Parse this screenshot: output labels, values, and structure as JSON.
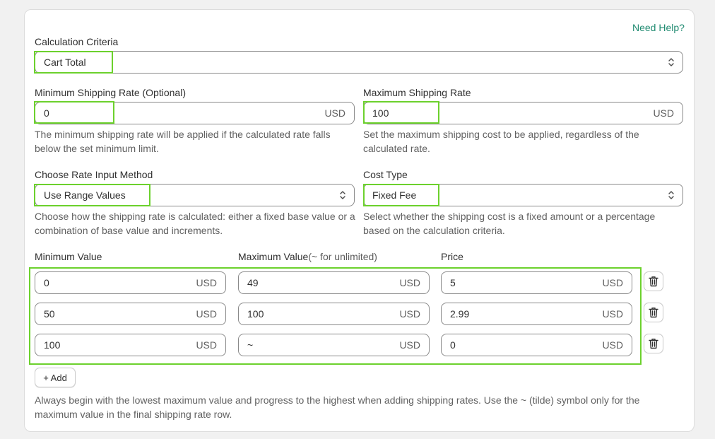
{
  "help_link": "Need Help?",
  "calculation_criteria": {
    "label": "Calculation Criteria",
    "value": "Cart Total"
  },
  "min_rate": {
    "label": "Minimum Shipping Rate (Optional)",
    "value": "0",
    "unit": "USD",
    "help": "The minimum shipping rate will be applied if the calculated rate falls below the set minimum limit."
  },
  "max_rate": {
    "label": "Maximum Shipping Rate",
    "value": "100",
    "unit": "USD",
    "help": "Set the maximum shipping cost to be applied, regardless of the calculated rate."
  },
  "rate_method": {
    "label": "Choose Rate Input Method",
    "value": "Use Range Values",
    "help": "Choose how the shipping rate is calculated: either a fixed base value or a combination of base value and increments."
  },
  "cost_type": {
    "label": "Cost Type",
    "value": "Fixed Fee",
    "help": "Select whether the shipping cost is a fixed amount or a percentage based on the calculation criteria."
  },
  "ranges": {
    "col_min": "Minimum Value",
    "col_max": "Maximum Value",
    "col_max_note": "(~ for unlimited)",
    "col_price": "Price",
    "unit": "USD",
    "rows": [
      {
        "min": "0",
        "max": "49",
        "price": "5"
      },
      {
        "min": "50",
        "max": "100",
        "price": "2.99"
      },
      {
        "min": "100",
        "max": "~",
        "price": "0"
      }
    ]
  },
  "add_button": "+ Add",
  "footer_note": "Always begin with the lowest maximum value and progress to the highest when adding shipping rates. Use the ~ (tilde) symbol only for the maximum value in the final shipping rate row."
}
